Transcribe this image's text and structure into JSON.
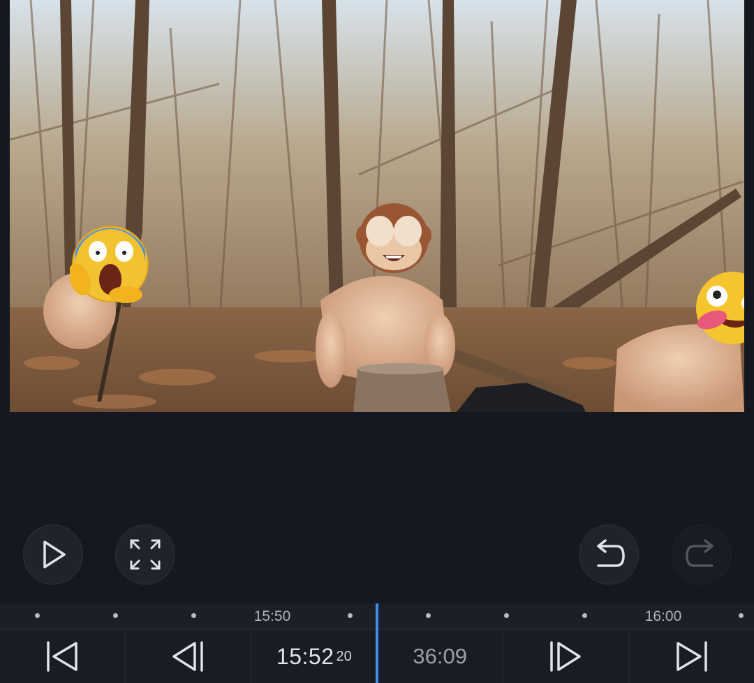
{
  "preview": {
    "emojis": [
      "face-screaming-in-fear-emoji",
      "see-no-evil-monkey-emoji",
      "zany-face-emoji"
    ]
  },
  "controls": {
    "play_icon": "play-icon",
    "fullscreen_icon": "expand-icon",
    "undo_icon": "undo-icon",
    "redo_icon": "redo-icon",
    "redo_enabled": false
  },
  "timeline": {
    "labels": [
      "15:50",
      "16:00"
    ]
  },
  "transport": {
    "current_time": "15:52",
    "current_frames": "20",
    "duration": "36:09"
  },
  "colors": {
    "background": "#151820",
    "playhead": "#3d8fe8"
  }
}
